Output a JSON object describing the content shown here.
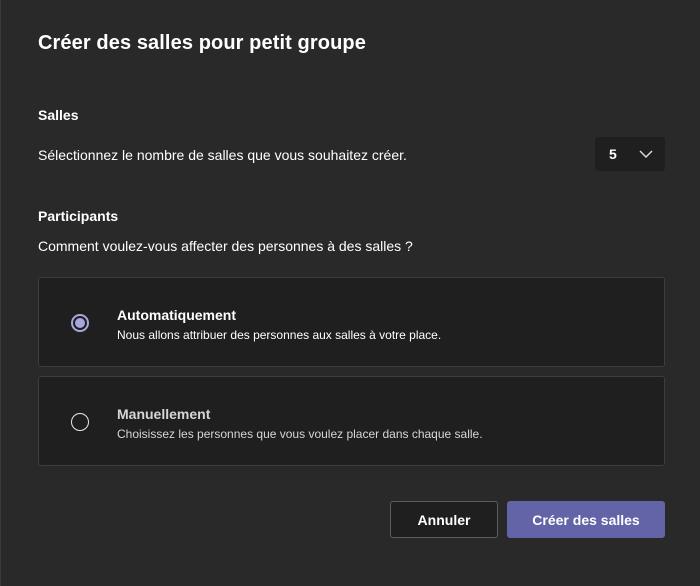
{
  "dialog": {
    "title": "Créer des salles pour petit groupe"
  },
  "rooms": {
    "heading": "Salles",
    "description": "Sélectionnez le nombre de salles que vous souhaitez créer.",
    "count_value": "5",
    "dropdown_icon": "chevron-down-icon"
  },
  "participants": {
    "heading": "Participants",
    "question": "Comment voulez-vous affecter des personnes à des salles ?",
    "options": [
      {
        "title": "Automatiquement",
        "description": "Nous allons attribuer des personnes aux salles à votre place.",
        "selected": true
      },
      {
        "title": "Manuellement",
        "description": "Choisissez les personnes que vous voulez placer dans chaque salle.",
        "selected": false
      }
    ]
  },
  "actions": {
    "cancel_label": "Annuler",
    "create_label": "Créer des salles"
  },
  "colors": {
    "background": "#292929",
    "card": "#1f1f1f",
    "accent": "#6264a7",
    "radio_selected": "#a6a7dc"
  }
}
